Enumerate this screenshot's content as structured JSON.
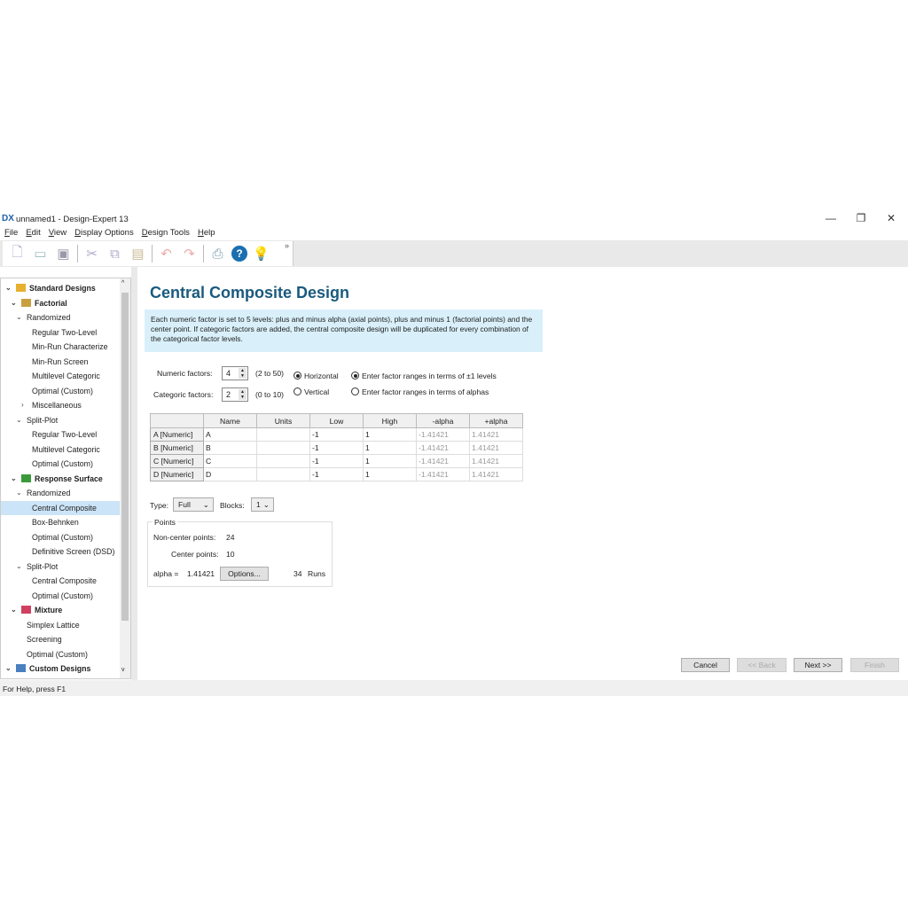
{
  "window": {
    "logo": "DX",
    "title": "unnamed1 - Design-Expert 13",
    "minimize": "—",
    "restore": "❐",
    "close": "✕"
  },
  "menu": [
    "File",
    "Edit",
    "View",
    "Display Options",
    "Design Tools",
    "Help"
  ],
  "toolbar": {
    "more": "»"
  },
  "sidebar": [
    {
      "label": "Standard Designs",
      "level": 0,
      "bold": true,
      "chev": "v",
      "icon": "folder"
    },
    {
      "label": "Factorial",
      "level": 1,
      "bold": true,
      "chev": "v",
      "icon": "grid"
    },
    {
      "label": "Randomized",
      "level": 1.5,
      "chev": "v"
    },
    {
      "label": "Regular Two-Level",
      "level": 2
    },
    {
      "label": "Min-Run Characterize",
      "level": 2
    },
    {
      "label": "Min-Run Screen",
      "level": 2
    },
    {
      "label": "Multilevel Categoric",
      "level": 2
    },
    {
      "label": "Optimal (Custom)",
      "level": 2
    },
    {
      "label": "Miscellaneous",
      "level": 1.6,
      "chev": ">"
    },
    {
      "label": "Split-Plot",
      "level": 1.5,
      "chev": "v"
    },
    {
      "label": "Regular Two-Level",
      "level": 2
    },
    {
      "label": "Multilevel Categoric",
      "level": 2
    },
    {
      "label": "Optimal (Custom)",
      "level": 2
    },
    {
      "label": "Response Surface",
      "level": 1,
      "bold": true,
      "chev": "v",
      "icon": "surface"
    },
    {
      "label": "Randomized",
      "level": 1.5,
      "chev": "v"
    },
    {
      "label": "Central Composite",
      "level": 2,
      "selected": true
    },
    {
      "label": "Box-Behnken",
      "level": 2
    },
    {
      "label": "Optimal (Custom)",
      "level": 2
    },
    {
      "label": "Definitive Screen (DSD)",
      "level": 2
    },
    {
      "label": "Split-Plot",
      "level": 1.5,
      "chev": "v"
    },
    {
      "label": "Central Composite",
      "level": 2
    },
    {
      "label": "Optimal (Custom)",
      "level": 2
    },
    {
      "label": "Mixture",
      "level": 1,
      "bold": true,
      "chev": "v",
      "icon": "flask"
    },
    {
      "label": "Simplex Lattice",
      "level": 1.8
    },
    {
      "label": "Screening",
      "level": 1.8
    },
    {
      "label": "Optimal (Custom)",
      "level": 1.8
    },
    {
      "label": "Custom Designs",
      "level": 0,
      "bold": true,
      "chev": "v",
      "icon": "monitor"
    }
  ],
  "main": {
    "title": "Central Composite Design",
    "info": "Each numeric factor is set to 5 levels: plus and minus alpha (axial points), plus and minus 1 (factorial points) and the center point. If categoric factors are added, the central composite design will be duplicated for every combination of the categorical factor levels.",
    "numeric_label": "Numeric factors:",
    "numeric_value": "4",
    "numeric_range": "(2 to 50)",
    "categoric_label": "Categoric factors:",
    "categoric_value": "2",
    "categoric_range": "(0 to 10)",
    "orient_horizontal": "Horizontal",
    "orient_vertical": "Vertical",
    "range_levels": "Enter factor ranges in terms of ±1 levels",
    "range_alphas": "Enter factor ranges in terms of alphas",
    "table": {
      "headers": [
        "",
        "Name",
        "Units",
        "Low",
        "High",
        "-alpha",
        "+alpha"
      ],
      "rows": [
        [
          "A [Numeric]",
          "A",
          "",
          "-1",
          "1",
          "-1.41421",
          "1.41421"
        ],
        [
          "B [Numeric]",
          "B",
          "",
          "-1",
          "1",
          "-1.41421",
          "1.41421"
        ],
        [
          "C [Numeric]",
          "C",
          "",
          "-1",
          "1",
          "-1.41421",
          "1.41421"
        ],
        [
          "D [Numeric]",
          "D",
          "",
          "-1",
          "1",
          "-1.41421",
          "1.41421"
        ]
      ]
    },
    "type_label": "Type:",
    "type_value": "Full",
    "blocks_label": "Blocks:",
    "blocks_value": "1",
    "points": {
      "legend": "Points",
      "noncenter_label": "Non-center points:",
      "noncenter_value": "24",
      "center_label": "Center points:",
      "center_value": "10",
      "alpha_label": "alpha =",
      "alpha_value": "1.41421",
      "options": "Options...",
      "runs_value": "34",
      "runs_label": "Runs"
    },
    "buttons": {
      "cancel": "Cancel",
      "back": "<< Back",
      "next": "Next >>",
      "finish": "Finish"
    }
  },
  "status": "For Help, press F1"
}
